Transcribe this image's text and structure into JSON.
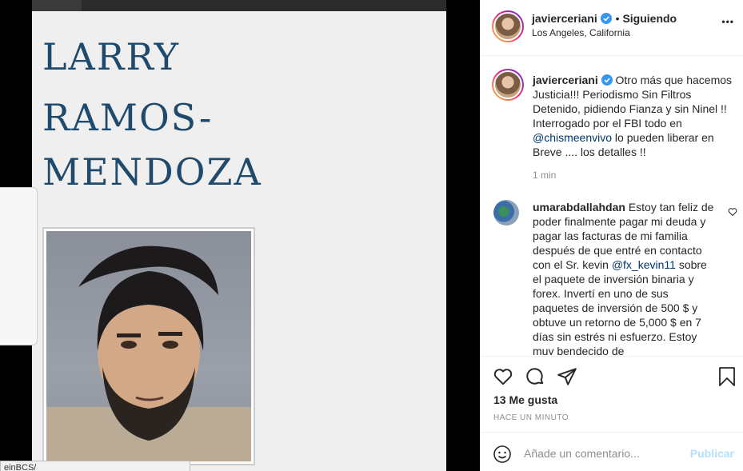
{
  "post_image": {
    "name_lines": [
      "LARRY",
      "RAMOS-",
      "MENDOZA"
    ],
    "url_tooltip": "einBCS/"
  },
  "header": {
    "username": "javierceriani",
    "follow_status": "Siguiendo",
    "location": "Los Angeles, California",
    "more": "•••"
  },
  "caption": {
    "username": "javierceriani",
    "text_part1": "Otro más que hacemos Justicia!!! Periodismo Sin Filtros Detenido, pidiendo Fianza y sin Ninel !! Interrogado por el FBI todo en ",
    "mention": "@chismeenvivo",
    "text_part2": " lo pueden liberar en Breve .... los detalles !!",
    "time": "1 min"
  },
  "comment": {
    "username": "umarabdallahdan",
    "text_part1": "Estoy tan feliz de poder finalmente pagar mi deuda y pagar las facturas de mi familia después de que entré en contacto con el Sr. kevin ",
    "mention": "@fx_kevin11",
    "text_part2": " sobre el paquete de inversión binaria y forex. Invertí en uno de sus paquetes de inversión de 500 $ y obtuve un retorno de 5,000 $ en 7 días sin estrés ni esfuerzo. Estoy muy bendecido de"
  },
  "actions": {
    "likes": "13 Me gusta",
    "timestamp": "HACE UN MINUTO"
  },
  "add_comment": {
    "placeholder": "Añade un comentario...",
    "publish": "Publicar"
  },
  "colors": {
    "verified": "#3897f0",
    "link": "#00376b",
    "publish_disabled": "#b2dffc",
    "name_text": "#1f4a6c"
  }
}
